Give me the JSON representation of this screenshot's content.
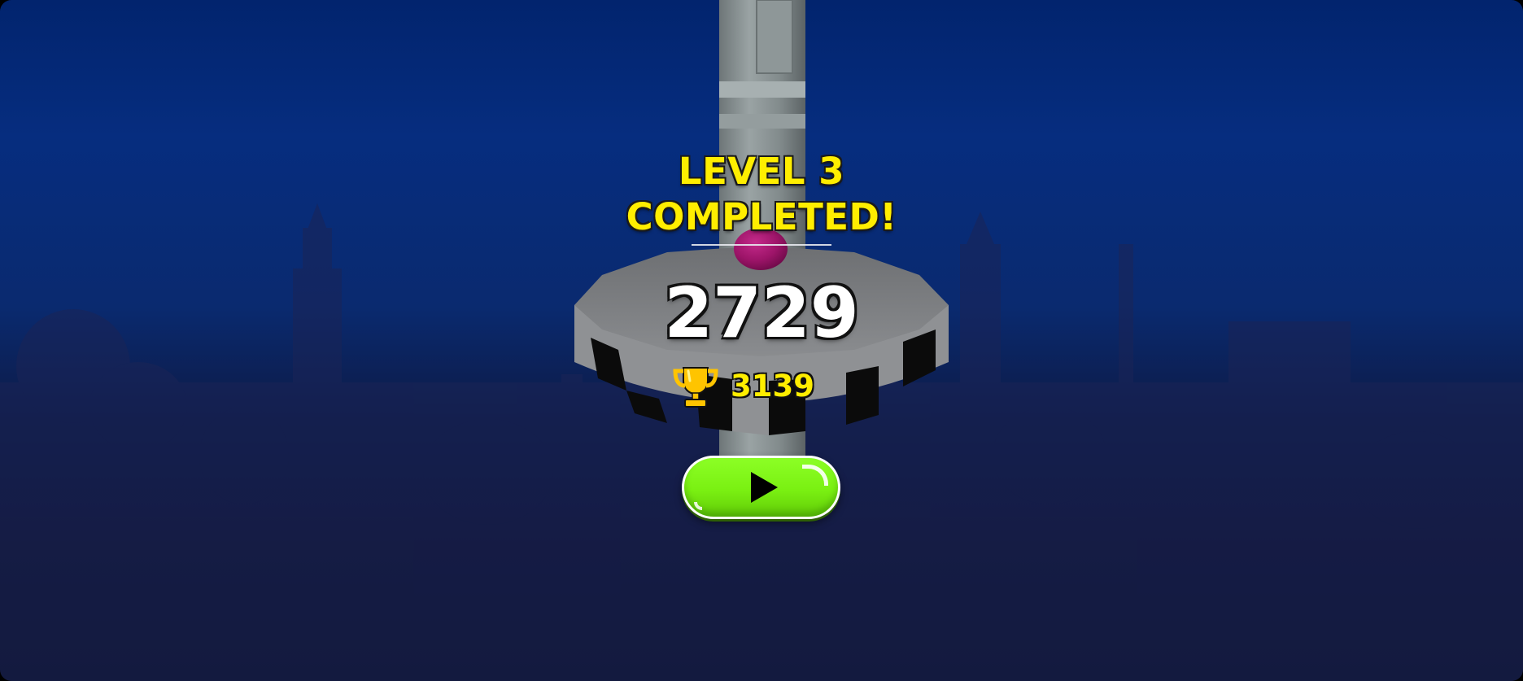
{
  "game": {
    "title_line_1": "LEVEL 3",
    "title_line_2": "COMPLETED!",
    "level": 3,
    "score": "2729",
    "best_score": "3139"
  },
  "icons": {
    "trophy": "trophy-icon",
    "play": "play-icon"
  },
  "colors": {
    "title": "#ffee00",
    "score": "#ffffff",
    "play_button": "#7af012",
    "ball": "#a0156b"
  }
}
